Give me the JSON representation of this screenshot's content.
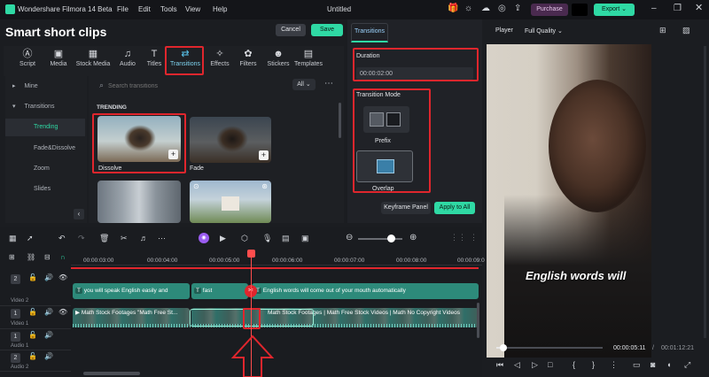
{
  "app": {
    "title": "Wondershare Filmora 14 Beta",
    "menu": [
      "File",
      "Edit",
      "Tools",
      "View",
      "Help"
    ],
    "doc_title": "Untitled",
    "purchase_label": "Purchase",
    "export_label": "Export"
  },
  "header": {
    "section_title": "Smart short clips",
    "cancel_label": "Cancel",
    "save_label": "Save"
  },
  "categories": [
    "Script",
    "Media",
    "Stock Media",
    "Audio",
    "Titles",
    "Transitions",
    "Effects",
    "Filters",
    "Stickers",
    "Templates"
  ],
  "nav": {
    "mine": "Mine",
    "transitions": "Transitions",
    "items": [
      "Trending",
      "Fade&Dissolve",
      "Zoom",
      "Slides"
    ]
  },
  "search": {
    "placeholder": "Search transitions",
    "filter": "All"
  },
  "content": {
    "section_label": "TRENDING",
    "items": [
      {
        "label": "Dissolve"
      },
      {
        "label": "Fade"
      }
    ]
  },
  "panel": {
    "tab": "Transitions",
    "duration_label": "Duration",
    "duration_value": "00:00:02:00",
    "mode_label": "Transition Mode",
    "mode_prefix": "Prefix",
    "mode_overlap": "Overlap",
    "keyframe_label": "Keyframe Panel",
    "apply_all_label": "Apply to All"
  },
  "player": {
    "label": "Player",
    "quality": "Full Quality",
    "subtitle": "English words will",
    "current_time": "00:00:05:11",
    "total_time": "00:01:12:21",
    "progress": 0.07
  },
  "timeline": {
    "ruler": [
      "00:00:03:00",
      "00:00:04:00",
      "00:00:05:00",
      "00:00:06:00",
      "00:00:07:00",
      "00:00:08:00",
      "00:00:09:0"
    ],
    "tracks": [
      "Video 2",
      "Video 1",
      "Audio 1",
      "Audio 2"
    ],
    "track_nums": [
      "2",
      "1",
      "1",
      "2"
    ],
    "title_clips": [
      "you will speak English easily and",
      "fast",
      "English words will come out of your mouth automatically"
    ],
    "video_clips": [
      "Math Stock Footages \"Math Free St...",
      "Math Stock Footages | Math Free Stock Videos | Math No Copyright Videos"
    ]
  },
  "colors": {
    "accent": "#2fd9a4",
    "highlight": "#e0262d",
    "playhead": "#ff4d4d",
    "title_clip": "#2d8a7a",
    "video_clip": "#2f6f68"
  }
}
